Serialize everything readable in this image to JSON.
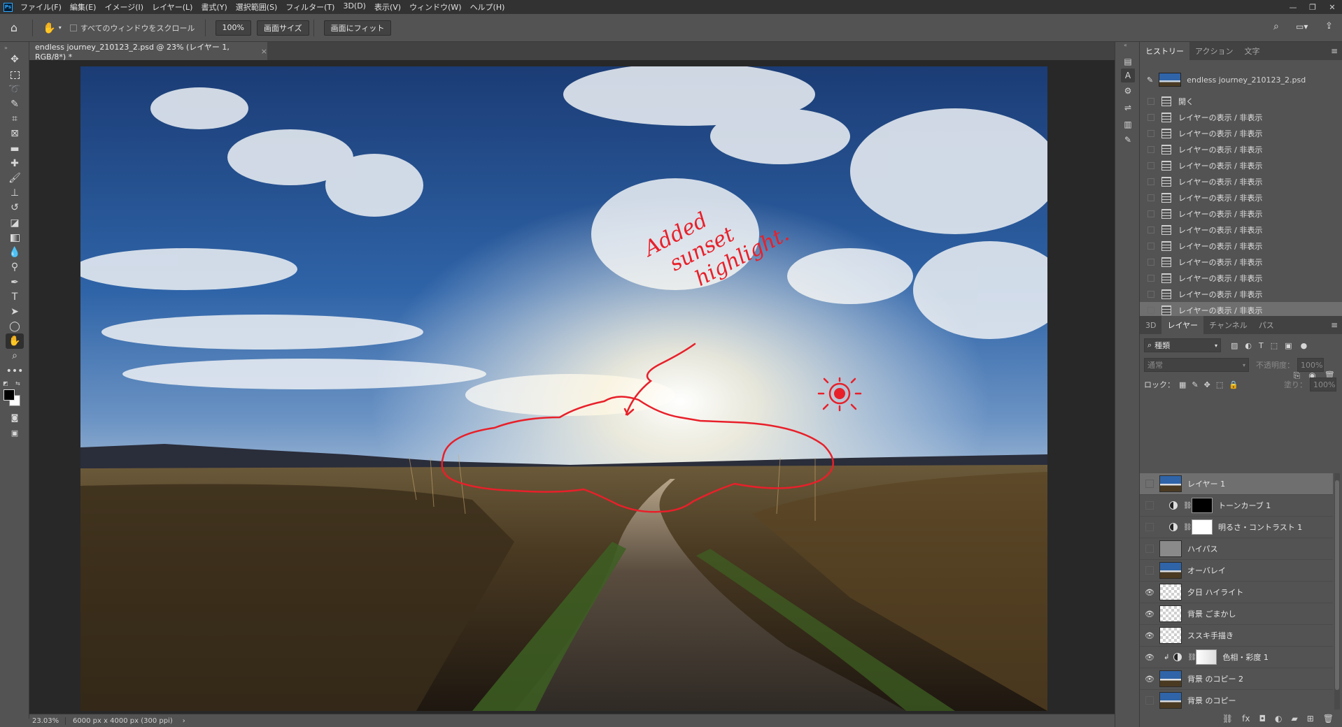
{
  "app": {
    "logo": "Ps"
  },
  "menu": [
    "ファイル(F)",
    "編集(E)",
    "イメージ(I)",
    "レイヤー(L)",
    "書式(Y)",
    "選択範囲(S)",
    "フィルター(T)",
    "3D(D)",
    "表示(V)",
    "ウィンドウ(W)",
    "ヘルプ(H)"
  ],
  "options_bar": {
    "scroll_all_label": "すべてのウィンドウをスクロール",
    "zoom_value": "100%",
    "fit_screen_label": "画面サイズ",
    "fill_screen_label": "画面にフィット"
  },
  "document": {
    "tab_title": "endless journey_210123_2.psd @ 23% (レイヤー 1, RGB/8*) *",
    "tab_close": "×"
  },
  "status": {
    "zoom": "23.03%",
    "info": "6000 px x 4000 px (300 ppi)",
    "arrow": "›"
  },
  "annotation": {
    "handwritten_lines": [
      "Added",
      "sunset",
      "highlight."
    ],
    "color": "#e8202a"
  },
  "history_panel": {
    "tabs": [
      "ヒストリー",
      "アクション",
      "文字"
    ],
    "snapshot_name": "endless journey_210123_2.psd",
    "states": [
      "開く",
      "レイヤーの表示 / 非表示",
      "レイヤーの表示 / 非表示",
      "レイヤーの表示 / 非表示",
      "レイヤーの表示 / 非表示",
      "レイヤーの表示 / 非表示",
      "レイヤーの表示 / 非表示",
      "レイヤーの表示 / 非表示",
      "レイヤーの表示 / 非表示",
      "レイヤーの表示 / 非表示",
      "レイヤーの表示 / 非表示",
      "レイヤーの表示 / 非表示",
      "レイヤーの表示 / 非表示",
      "レイヤーの表示 / 非表示"
    ],
    "selected_index": 13
  },
  "layers_panel": {
    "tabs": [
      "3D",
      "レイヤー",
      "チャンネル",
      "パス"
    ],
    "filter_kind": "種類",
    "blend_mode": "通常",
    "opacity_label": "不透明度：",
    "opacity_value": "100%",
    "lock_label": "ロック：",
    "fill_label": "塗り：",
    "fill_value": "100%",
    "layers": [
      {
        "name": "レイヤー 1",
        "type": "photo",
        "visible": false,
        "selected": true
      },
      {
        "name": "トーンカーブ 1",
        "type": "adjust-black",
        "visible": false,
        "selected": false
      },
      {
        "name": "明るさ・コントラスト 1",
        "type": "adjust-white",
        "visible": false,
        "selected": false
      },
      {
        "name": "ハイパス",
        "type": "gray",
        "visible": false,
        "selected": false
      },
      {
        "name": "オーバレイ",
        "type": "photo",
        "visible": false,
        "selected": false
      },
      {
        "name": "夕日 ハイライト",
        "type": "transparent",
        "visible": true,
        "selected": false
      },
      {
        "name": "背景 ごまかし",
        "type": "transparent",
        "visible": true,
        "selected": false
      },
      {
        "name": "ススキ手描き",
        "type": "transparent",
        "visible": true,
        "selected": false
      },
      {
        "name": "色相・彩度 1",
        "type": "adjust-clipped",
        "visible": true,
        "selected": false
      },
      {
        "name": "背景 のコピー 2",
        "type": "photo",
        "visible": true,
        "selected": false
      },
      {
        "name": "背景 のコピー",
        "type": "photo",
        "visible": false,
        "selected": false
      }
    ]
  }
}
